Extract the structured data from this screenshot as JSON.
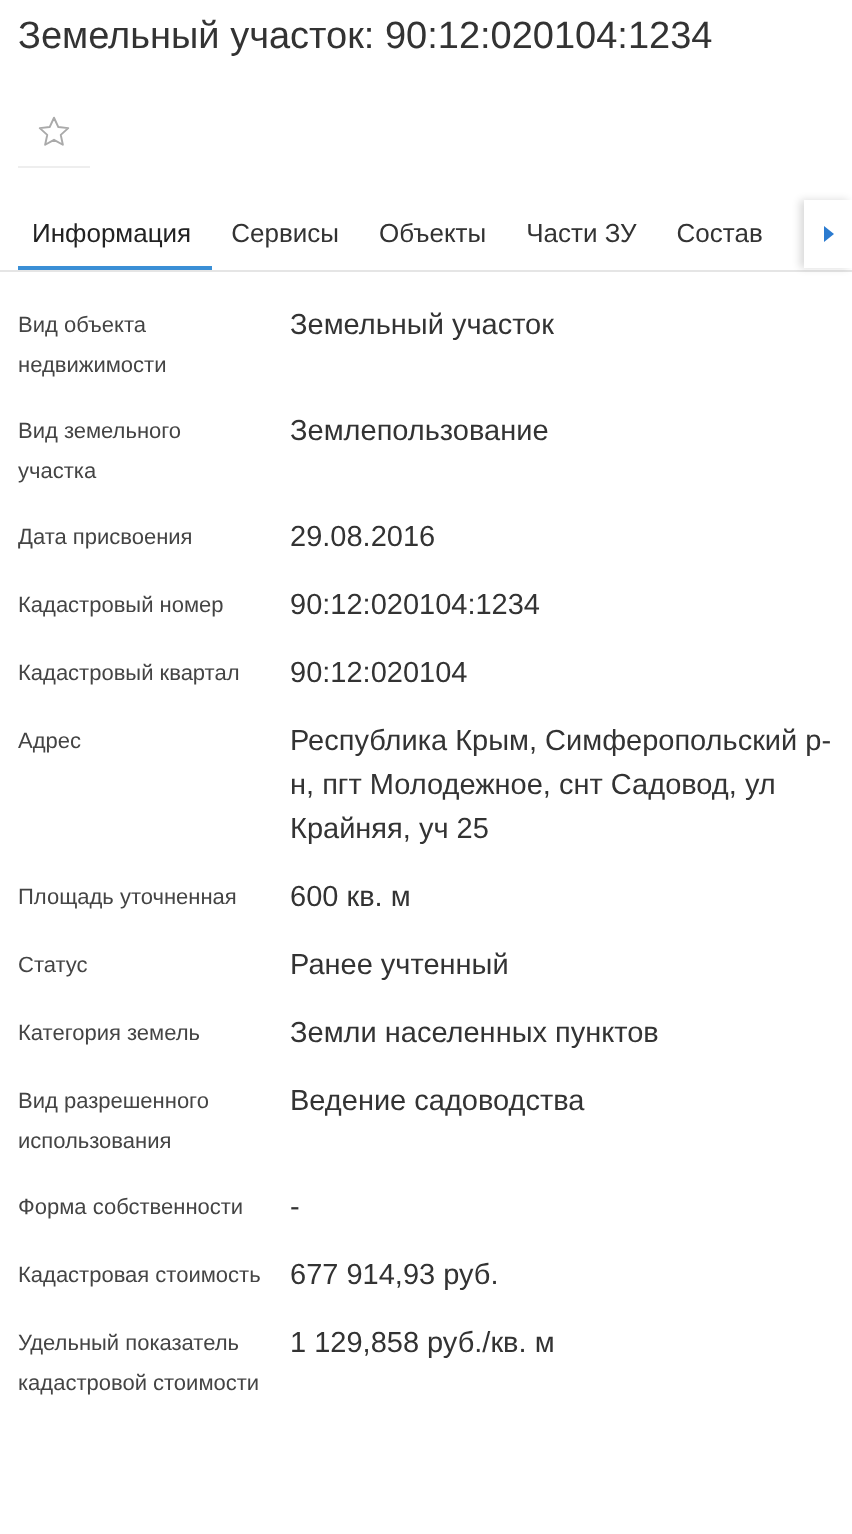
{
  "title": "Земельный участок: 90:12:020104:1234",
  "favorite": {
    "starred": false
  },
  "tabs": [
    {
      "label": "Информация",
      "selected": true
    },
    {
      "label": "Сервисы",
      "selected": false
    },
    {
      "label": "Объекты",
      "selected": false
    },
    {
      "label": "Части ЗУ",
      "selected": false
    },
    {
      "label": "Состав",
      "selected": false
    }
  ],
  "fields": [
    {
      "label": "Вид объекта недвижимости",
      "value": "Земельный участок"
    },
    {
      "label": "Вид земельного участка",
      "value": "Землепользование"
    },
    {
      "label": "Дата присвоения",
      "value": "29.08.2016"
    },
    {
      "label": "Кадастровый номер",
      "value": "90:12:020104:1234"
    },
    {
      "label": "Кадастровый квартал",
      "value": "90:12:020104"
    },
    {
      "label": "Адрес",
      "value": "Республика Крым, Симферопольский р-н, пгт Молодежное, снт Садовод, ул Крайняя, уч 25"
    },
    {
      "label": "Площадь уточненная",
      "value": "600 кв. м"
    },
    {
      "label": "Статус",
      "value": "Ранее учтенный"
    },
    {
      "label": "Категория земель",
      "value": "Земли населенных пунктов"
    },
    {
      "label": "Вид разрешенного использования",
      "value": "Ведение садоводства"
    },
    {
      "label": "Форма собственности",
      "value": "-"
    },
    {
      "label": "Кадастровая стоимость",
      "value": "677 914,93 руб."
    },
    {
      "label": "Удельный показатель кадастровой стоимости",
      "value": "1 129,858 руб./кв. м"
    }
  ]
}
